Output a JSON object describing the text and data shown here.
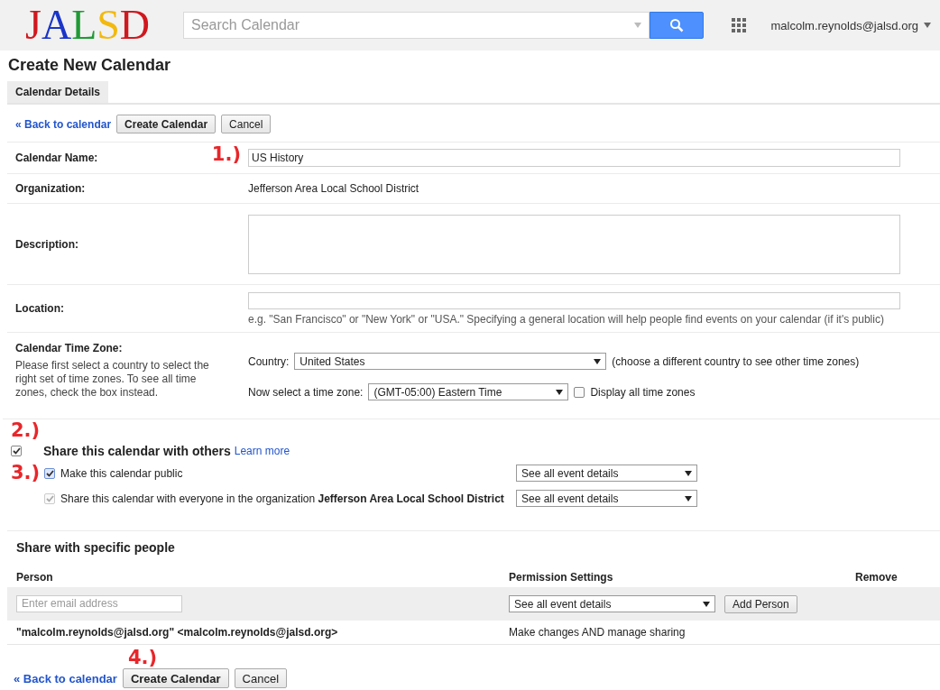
{
  "header": {
    "logo": [
      {
        "text": "J",
        "color": "#d0181f"
      },
      {
        "text": "A",
        "color": "#1a35c8"
      },
      {
        "text": "L",
        "color": "#1f9a35"
      },
      {
        "text": "S",
        "color": "#f2b90f"
      },
      {
        "text": "D",
        "color": "#d0181f"
      }
    ],
    "search": {
      "placeholder": "Search Calendar"
    },
    "account": "malcolm.reynolds@jalsd.org"
  },
  "page_title": "Create New Calendar",
  "tabs": [
    {
      "label": "Calendar Details",
      "selected": true
    }
  ],
  "top_actions": {
    "back_link": "« Back to calendar",
    "buttons": [
      "Create Calendar",
      "Cancel"
    ]
  },
  "form": {
    "calendar_name": {
      "label": "Calendar Name:",
      "value": "US History",
      "annotation": "1.)"
    },
    "organization": {
      "label": "Organization:",
      "value": "Jefferson Area Local School District"
    },
    "description": {
      "label": "Description:"
    },
    "location": {
      "label": "Location:",
      "hint": "e.g. \"San Francisco\" or \"New York\" or \"USA.\" Specifying a general location will help people find events on your calendar (if it's public)"
    },
    "time_zone": {
      "label": "Calendar Time Zone:",
      "help": "Please first select a country to select the right set of time zones. To see all time zones, check the box instead.",
      "country_label": "Country:",
      "country": "United States",
      "country_note": "(choose a different country to see other time zones)",
      "zone_label": "Now select a time zone:",
      "zone": "(GMT-05:00) Eastern Time",
      "display_all": {
        "label": "Display all time zones",
        "checked": false
      }
    }
  },
  "sharing": {
    "annotation": "2.)",
    "share": {
      "label": "Share this calendar with others",
      "checked": true
    },
    "learn_more": "Learn more",
    "options": [
      {
        "annotation": "3.)",
        "text": "Make this calendar public",
        "checked": true,
        "disabled": false,
        "permission": "See all event details"
      },
      {
        "text": "Share this calendar with everyone in the organization **Jefferson Area Local School District**",
        "checked": true,
        "disabled": true,
        "permission": "See all event details"
      }
    ]
  },
  "specific_people": {
    "title": "Share with specific people",
    "columns": [
      "Person",
      "Permission Settings",
      "Remove"
    ],
    "add_row": {
      "placeholder": "Enter email address",
      "permission": "See all event details",
      "button": "Add Person"
    },
    "people": [
      {
        "person": "\"malcolm.reynolds@jalsd.org\" <malcolm.reynolds@jalsd.org>",
        "permission": "Make changes AND manage sharing"
      }
    ]
  },
  "bottom_actions": {
    "annotation": "4.)",
    "back_link": "« Back to calendar",
    "buttons": [
      "Create Calendar",
      "Cancel"
    ]
  }
}
